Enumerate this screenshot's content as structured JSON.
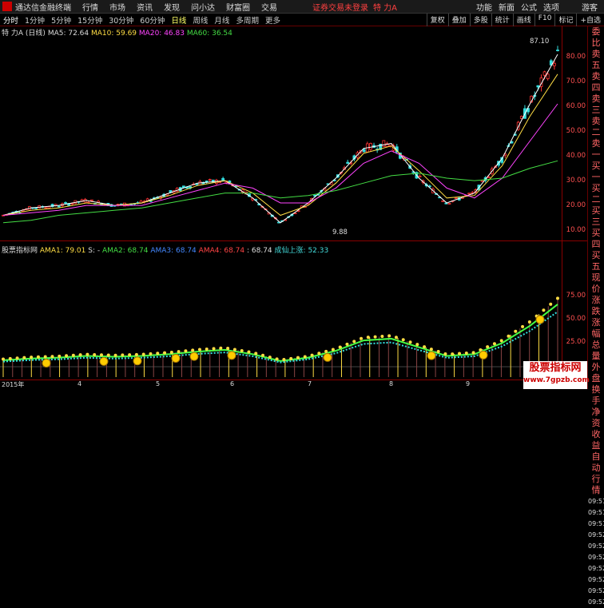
{
  "topbar": {
    "app": "通达信金融终端",
    "menus": [
      "行情",
      "市场",
      "资讯",
      "发现",
      "问小达",
      "财富圈",
      "交易"
    ],
    "warning": "证券交易未登录",
    "stock_title": "特 力A",
    "right_menus": [
      "功能",
      "新面",
      "公式",
      "选项",
      "游客"
    ]
  },
  "tabbar": {
    "periods": [
      "分时",
      "1分钟",
      "5分钟",
      "15分钟",
      "30分钟",
      "60分钟",
      "日线",
      "周线",
      "月线",
      "多周期",
      "更多"
    ],
    "selected": "日线",
    "tools": [
      "复权",
      "叠加",
      "多股",
      "统计",
      "画线",
      "F10",
      "标记",
      "+自选"
    ]
  },
  "main_info": {
    "stock": "特 力A",
    "period": "(日线)",
    "ma5": "MA5: 72.64",
    "ma10": "MA10: 59.69",
    "ma20": "MA20: 46.83",
    "ma60": "MA60: 36.54"
  },
  "price_axis": [
    "80.00",
    "70.00",
    "60.00",
    "50.00",
    "40.00",
    "30.00",
    "20.00",
    "10.00"
  ],
  "price_labels": {
    "high": "87.10",
    "low": "9.88"
  },
  "indicator_info": {
    "name": "股票指标网",
    "ama1": "AMA1: 79.01",
    "s": "S: -",
    "ama2": "AMA2: 68.74",
    "ama3": "AMA3: 68.74",
    "ama4": "AMA4: 68.74",
    "v": ": 68.74",
    "cxsz": "成仙上涨: 52.33"
  },
  "ind_axis": [
    "75.00",
    "50.00",
    "25.00"
  ],
  "side_panel": [
    "委比",
    "卖五",
    "卖四",
    "卖三",
    "卖二",
    "卖一",
    "买一",
    "买二",
    "买三",
    "买四",
    "买五",
    "现价",
    "涨跌",
    "涨幅",
    "总量",
    "外盘",
    "换手",
    "净资",
    "收益",
    "自动",
    "行情"
  ],
  "side_times": [
    "09:51",
    "09:51",
    "09:51",
    "09:52",
    "09:52",
    "09:52",
    "09:52",
    "09:52",
    "09:52",
    "09:52"
  ],
  "xaxis": [
    "2015年",
    "4",
    "5",
    "6",
    "7",
    "8",
    "9"
  ],
  "watermark": {
    "title": "股票指标网",
    "url": "www.7gpzb.com"
  },
  "colors": {
    "up": "#ff3333",
    "down": "#33dddd",
    "ma5": "#ffffff",
    "ma10": "#ffdd44",
    "ma20": "#ff44ff",
    "ma60": "#44dd44"
  },
  "chart_data": {
    "type": "line",
    "title": "",
    "ylim": [
      5,
      90
    ],
    "x": [
      0,
      10,
      20,
      30,
      40,
      50,
      60,
      70,
      80,
      90,
      100,
      110,
      120,
      130,
      140,
      150,
      160,
      170,
      180,
      190,
      200
    ],
    "series": [
      {
        "name": "MA5",
        "values": [
          15,
          18,
          19,
          21,
          19,
          20,
          24,
          28,
          29,
          22,
          12,
          20,
          30,
          42,
          44,
          30,
          20,
          24,
          38,
          60,
          80
        ]
      },
      {
        "name": "MA10",
        "values": [
          15,
          17,
          18,
          20,
          19,
          20,
          23,
          27,
          29,
          24,
          15,
          19,
          28,
          40,
          43,
          33,
          22,
          23,
          35,
          55,
          72
        ]
      },
      {
        "name": "MA20",
        "values": [
          15,
          16,
          17,
          19,
          19,
          19,
          22,
          25,
          28,
          26,
          20,
          20,
          26,
          36,
          41,
          36,
          26,
          22,
          30,
          45,
          60
        ]
      },
      {
        "name": "MA60",
        "values": [
          12,
          13,
          15,
          16,
          17,
          18,
          20,
          22,
          24,
          24,
          22,
          23,
          25,
          28,
          31,
          32,
          30,
          29,
          30,
          34,
          37
        ]
      }
    ]
  }
}
